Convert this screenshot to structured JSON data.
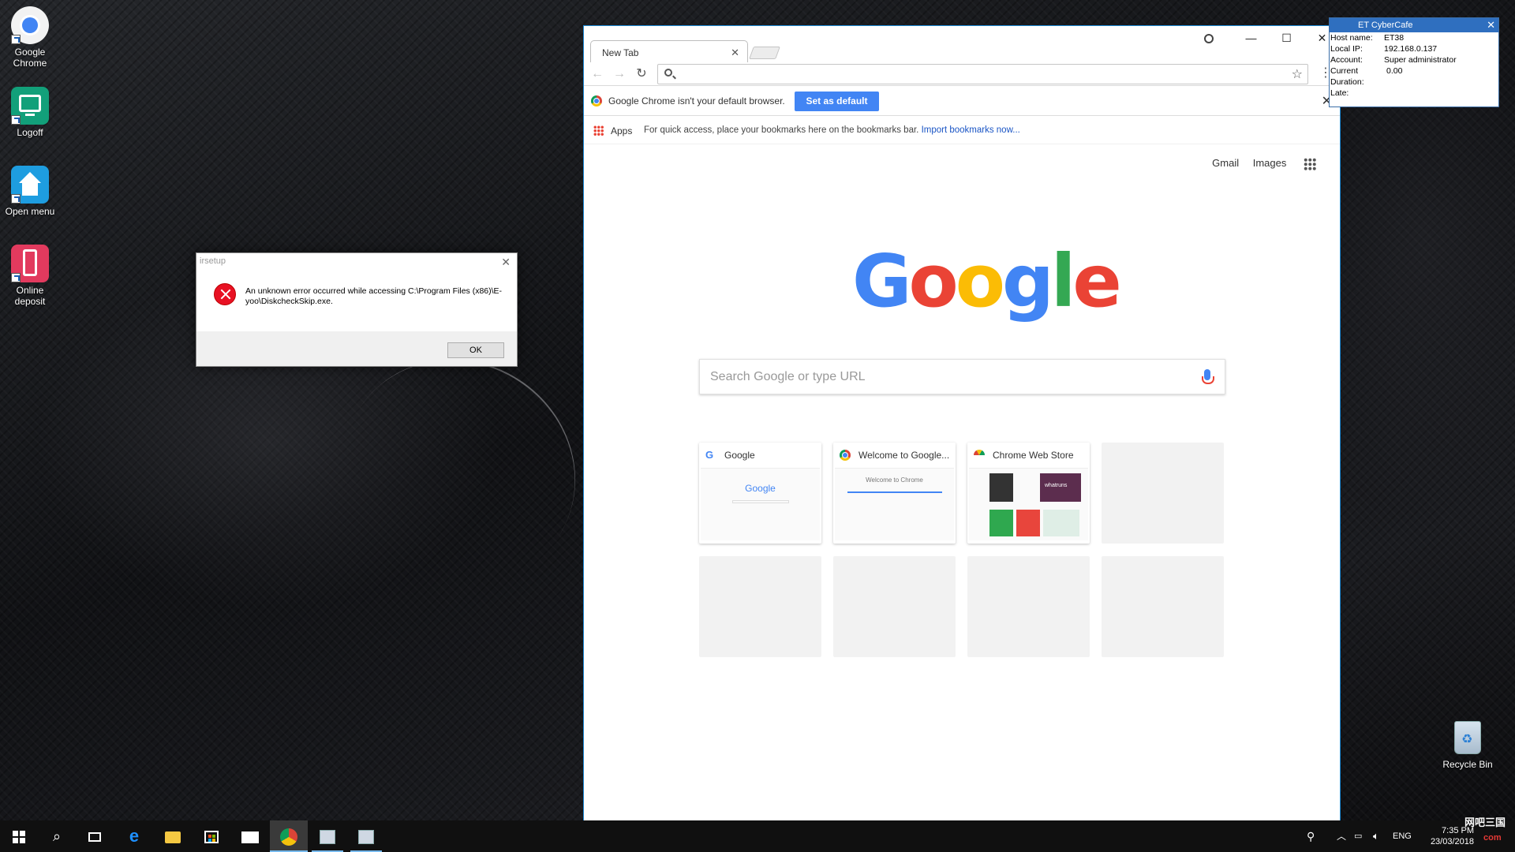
{
  "desktop": {
    "icons": [
      {
        "label": "Google Chrome",
        "icon": "chrome-icon"
      },
      {
        "label": "Logoff",
        "icon": "logoff-icon"
      },
      {
        "label": "Open menu",
        "icon": "home-icon"
      },
      {
        "label": "Online deposit",
        "icon": "phone-icon"
      }
    ],
    "recycle_bin": "Recycle Bin"
  },
  "error_dialog": {
    "title": "irsetup",
    "message": "An unknown error occurred while accessing C:\\Program Files (x86)\\E-yoo\\DiskcheckSkip.exe.",
    "ok_label": "OK"
  },
  "chrome": {
    "tab_title": "New Tab",
    "address_value": "",
    "infobar": {
      "text": "Google Chrome isn't your default browser.",
      "button": "Set as default"
    },
    "bookmarks": {
      "apps": "Apps",
      "hint": "For quick access, place your bookmarks here on the bookmarks bar.",
      "import": "Import bookmarks now..."
    },
    "ntp": {
      "gmail": "Gmail",
      "images": "Images",
      "logo": [
        "G",
        "o",
        "o",
        "g",
        "l",
        "e"
      ],
      "search_placeholder": "Search Google or type URL",
      "tiles": [
        {
          "title": "Google",
          "thumb_text": "Google"
        },
        {
          "title": "Welcome to Google...",
          "thumb_text": "Welcome to Chrome"
        },
        {
          "title": "Chrome Web Store",
          "thumb_text": "whatruns"
        }
      ]
    }
  },
  "cybercafe": {
    "title": "ET CyberCafe",
    "rows": [
      {
        "key": "Host name:",
        "value": "ET38"
      },
      {
        "key": "Local IP:",
        "value": "192.168.0.137"
      },
      {
        "key": "Account:",
        "value": "Super administrator"
      },
      {
        "key": "Current",
        "value": "0.00"
      },
      {
        "key": "Duration:",
        "value": ""
      },
      {
        "key": "Late:",
        "value": ""
      }
    ]
  },
  "taskbar": {
    "language": "ENG",
    "time": "7:35 PM",
    "date": "23/03/2018",
    "watermark": "网吧三国",
    "watermark_sub": "com"
  },
  "colors": {
    "chrome_blue": "#4285f4",
    "error_red": "#e81123",
    "taskbar": "#101010"
  }
}
